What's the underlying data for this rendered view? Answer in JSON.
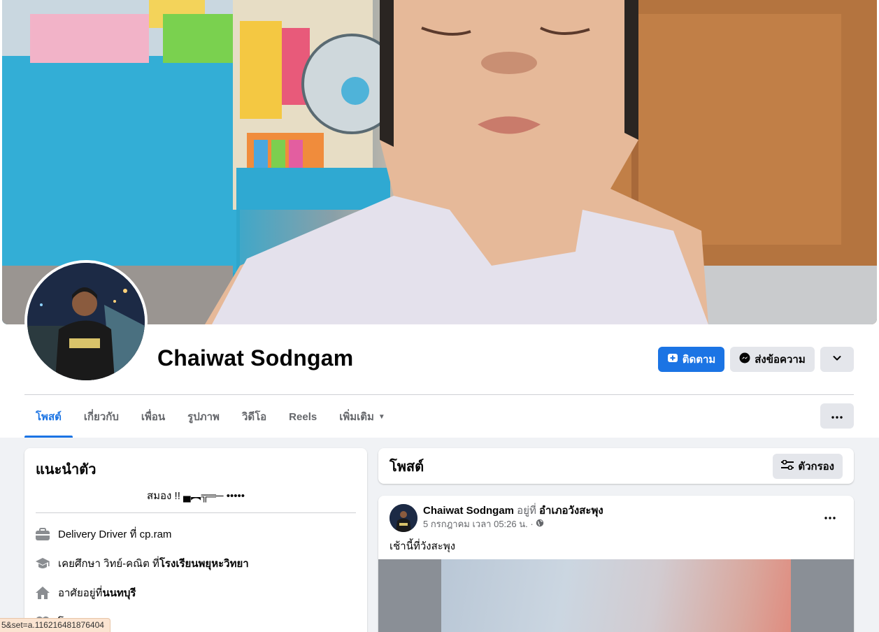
{
  "profile": {
    "name": "Chaiwat Sodngam"
  },
  "actions": {
    "follow_label": "ติดตาม",
    "message_label": "ส่งข้อความ"
  },
  "tabs": [
    {
      "label": "โพสต์",
      "active": true
    },
    {
      "label": "เกี่ยวกับ"
    },
    {
      "label": "เพื่อน"
    },
    {
      "label": "รูปภาพ"
    },
    {
      "label": "วิดีโอ"
    },
    {
      "label": "Reels"
    },
    {
      "label": "เพิ่มเติม"
    }
  ],
  "intro": {
    "title": "แนะนำตัว",
    "bio": "สมอง !! ▄︻╦═─ •••••",
    "work": {
      "prefix": "Delivery Driver ที่ cp.ram"
    },
    "education": {
      "prefix": "เคยศึกษา วิทย์-คณิต ที่ ",
      "school": "โรงเรียนพยุหะวิทยา"
    },
    "home": {
      "prefix": "อาศัยอยู่ที่ ",
      "place": "นนทบุรี"
    },
    "relationship": {
      "label": "โสด"
    }
  },
  "posts_header": {
    "title": "โพสต์",
    "filter_label": "ตัวกรอง"
  },
  "post": {
    "author": "Chaiwat Sodngam",
    "at_label": " อยู่ที่ ",
    "place": "อำเภอวังสะพุง",
    "timestamp": "5 กรกฎาคม เวลา 05:26 น. ·",
    "text": "เช้านี้ที่วังสะพุง"
  },
  "status_bar": {
    "url": "5&set=a.116216481876404"
  },
  "colors": {
    "accent": "#1b74e4",
    "page_bg": "#f0f2f5",
    "button_gray": "#e4e6eb"
  }
}
